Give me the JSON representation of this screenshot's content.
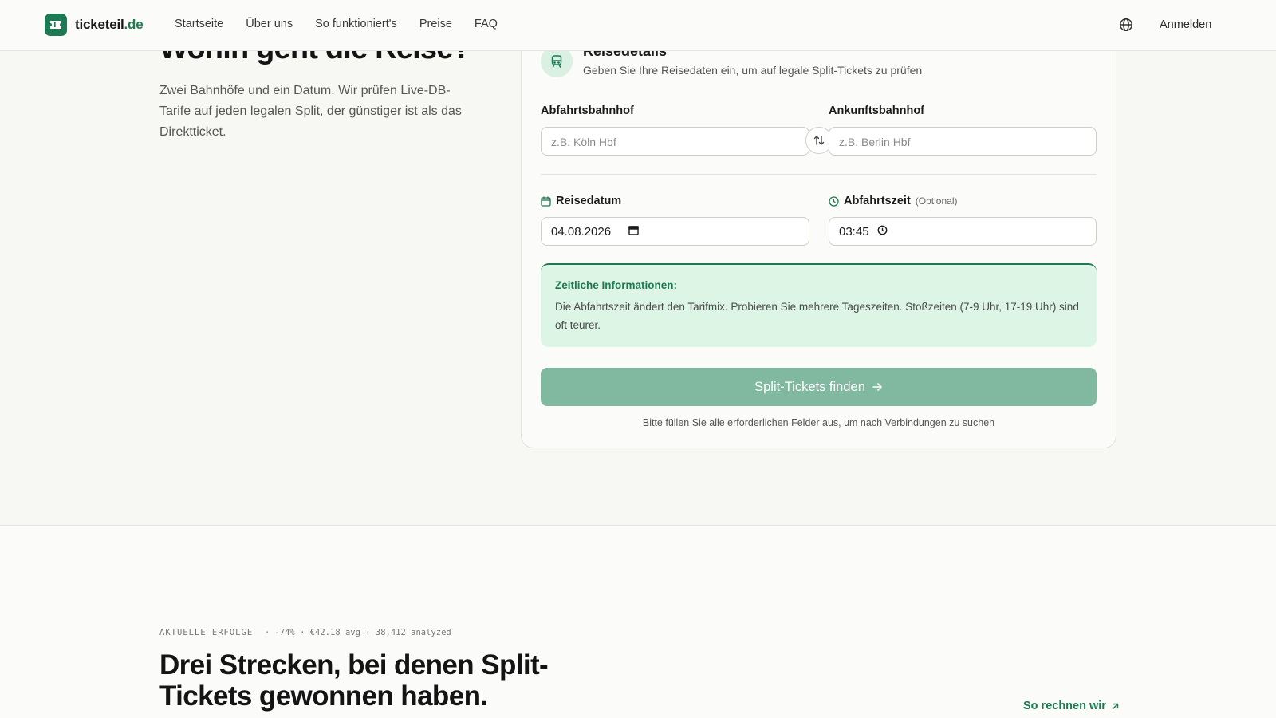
{
  "header": {
    "logo_name": "ticketeil",
    "logo_tld": ".de",
    "nav": [
      "Startseite",
      "Über uns",
      "So funktioniert's",
      "Preise",
      "FAQ"
    ],
    "login": "Anmelden"
  },
  "hero": {
    "title": "Wohin geht die Reise?",
    "subtitle": "Zwei Bahnhöfe und ein Datum. Wir prüfen Live-DB-Tarife auf jeden legalen Split, der günstiger ist als das Direktticket."
  },
  "card": {
    "title": "Reisedetails",
    "description": "Geben Sie Ihre Reisedaten ein, um auf legale Split-Tickets zu prüfen",
    "departure_label": "Abfahrtsbahnhof",
    "departure_placeholder": "z.B. Köln Hbf",
    "arrival_label": "Ankunftsbahnhof",
    "arrival_placeholder": "z.B. Berlin Hbf",
    "date_label": "Reisedatum",
    "date_value": "04.08.2026",
    "time_label": "Abfahrtszeit",
    "time_optional": "(Optional)",
    "time_value": "03:45",
    "info_title": "Zeitliche Informationen:",
    "info_text": "Die Abfahrtszeit ändert den Tarifmix. Probieren Sie mehrere Tageszeiten. Stoßzeiten (7-9 Uhr, 17-19 Uhr) sind oft teurer.",
    "cta": "Split-Tickets finden",
    "hint": "Bitte füllen Sie alle erforderlichen Felder aus, um nach Verbindungen zu suchen"
  },
  "lower": {
    "eyebrow": "AKTUELLE ERFOLGE",
    "stats": "· -74% · €42.18 avg · 38,412 analyzed",
    "title": "Drei Strecken, bei denen Split-Tickets gewonnen haben.",
    "link": "So rechnen wir"
  },
  "colors": {
    "accent": "#1e7a52",
    "accent_soft": "#dcf5e4",
    "cta_disabled": "#80b9a0"
  }
}
